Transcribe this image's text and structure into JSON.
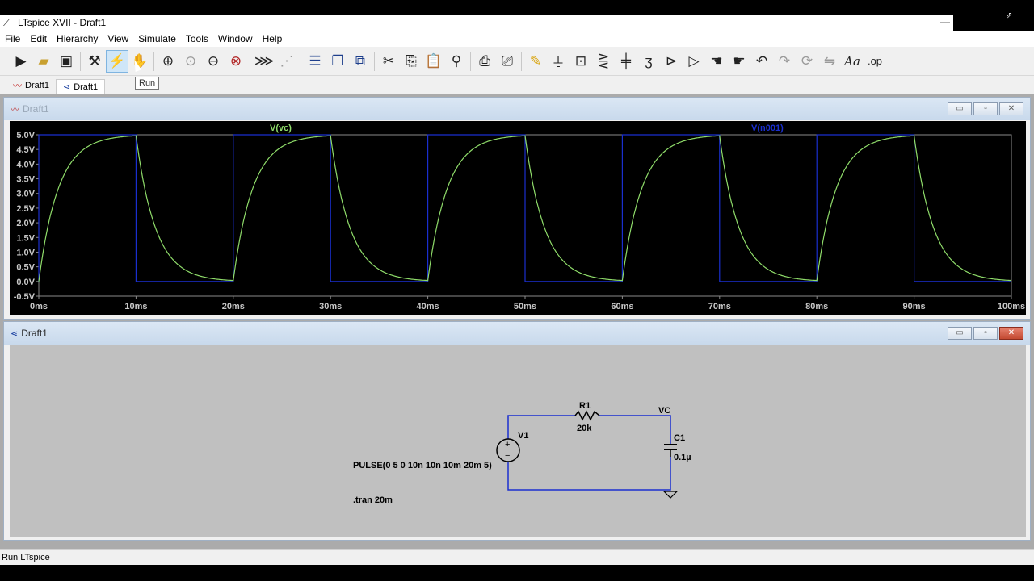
{
  "app": {
    "title": "LTspice XVII - Draft1"
  },
  "menu": [
    "File",
    "Edit",
    "Hierarchy",
    "View",
    "Simulate",
    "Tools",
    "Window",
    "Help"
  ],
  "toolbar": {
    "tooltip": "Run",
    "font_button": "Aa",
    "op_button": ".op"
  },
  "tabs": [
    {
      "label": "Draft1",
      "kind": "waveform"
    },
    {
      "label": "Draft1",
      "kind": "schematic"
    }
  ],
  "plot_window": {
    "title": "Draft1",
    "traces": [
      {
        "label": "V(vc)",
        "color": "#8fdc6a"
      },
      {
        "label": "V(n001)",
        "color": "#1a2fcf"
      }
    ]
  },
  "schematic_window": {
    "title": "Draft1",
    "components": {
      "r1_name": "R1",
      "r1_value": "20k",
      "c1_name": "C1",
      "c1_value": "0.1µ",
      "v1_name": "V1",
      "net_label": "VC",
      "source_spec": "PULSE(0 5 0 10n 10n 10m 20m 5)",
      "directive": ".tran 20m"
    }
  },
  "status": {
    "text": "Run LTspice"
  },
  "chart_data": {
    "type": "line",
    "x_unit": "ms",
    "xlim": [
      0,
      100
    ],
    "ylim": [
      -0.5,
      5.0
    ],
    "x_ticks": [
      "0ms",
      "10ms",
      "20ms",
      "30ms",
      "40ms",
      "50ms",
      "60ms",
      "70ms",
      "80ms",
      "90ms",
      "100ms"
    ],
    "y_ticks": [
      "-0.5V",
      "0.0V",
      "0.5V",
      "1.0V",
      "1.5V",
      "2.0V",
      "2.5V",
      "3.0V",
      "3.5V",
      "4.0V",
      "4.5V",
      "5.0V"
    ],
    "series": [
      {
        "name": "V(vc)",
        "description_points": [
          [
            0,
            0
          ],
          [
            2,
            3.2
          ],
          [
            4,
            4.3
          ],
          [
            6,
            4.75
          ],
          [
            10,
            4.95
          ],
          [
            12,
            1.7
          ],
          [
            14,
            0.6
          ],
          [
            16,
            0.22
          ],
          [
            20,
            0.05
          ],
          [
            22,
            3.25
          ],
          [
            24,
            4.4
          ],
          [
            26,
            4.8
          ],
          [
            30,
            4.97
          ],
          [
            32,
            1.7
          ],
          [
            34,
            0.6
          ],
          [
            36,
            0.22
          ],
          [
            40,
            0.05
          ],
          [
            42,
            3.25
          ],
          [
            44,
            4.4
          ],
          [
            46,
            4.8
          ],
          [
            50,
            4.97
          ],
          [
            52,
            1.7
          ],
          [
            54,
            0.6
          ],
          [
            56,
            0.22
          ],
          [
            60,
            0.05
          ],
          [
            62,
            3.25
          ],
          [
            64,
            4.4
          ],
          [
            66,
            4.8
          ],
          [
            70,
            4.97
          ],
          [
            72,
            1.7
          ],
          [
            74,
            0.6
          ],
          [
            76,
            0.22
          ],
          [
            80,
            0.05
          ],
          [
            82,
            3.25
          ],
          [
            84,
            4.4
          ],
          [
            86,
            4.8
          ],
          [
            90,
            4.97
          ],
          [
            92,
            1.7
          ],
          [
            94,
            0.6
          ],
          [
            96,
            0.22
          ],
          [
            100,
            0.05
          ]
        ]
      },
      {
        "name": "V(n001)",
        "square": {
          "high": 5.0,
          "low": 0.0,
          "period": 20,
          "on_time": 10,
          "cycles": 5
        }
      }
    ]
  }
}
